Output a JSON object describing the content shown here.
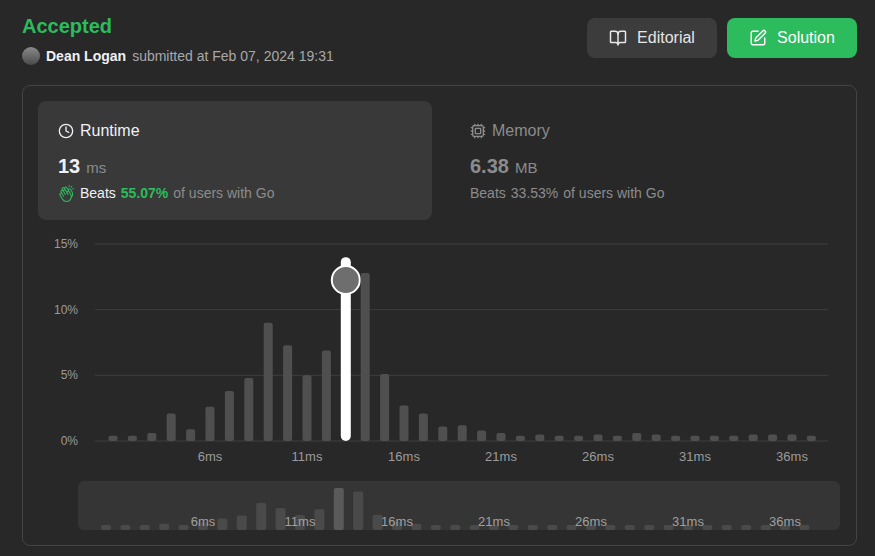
{
  "status": "Accepted",
  "submission": {
    "user": "Dean Logan",
    "submitted": "submitted at Feb 07, 2024 19:31"
  },
  "buttons": [
    {
      "label": "Editorial",
      "kind": "secondary"
    },
    {
      "label": "Solution",
      "kind": "primary"
    }
  ],
  "stats": [
    {
      "label": "Runtime",
      "kind": "runtime",
      "value": "13",
      "unit": "ms",
      "beats": "Beats",
      "percent": "55.07%",
      "suffix": "of users with Go",
      "selected": true
    },
    {
      "label": "Memory",
      "kind": "memory",
      "value": "6.38",
      "unit": "MB",
      "beats": "Beats",
      "percent": "33.53%",
      "suffix": "of users with Go",
      "selected": false
    }
  ],
  "chart": {
    "y_ticks": [
      "15%",
      "10%",
      "5%",
      "0%"
    ],
    "x_ticks": [
      "6ms",
      "11ms",
      "16ms",
      "21ms",
      "26ms",
      "31ms",
      "36ms"
    ],
    "bars": [
      {
        "value": 0.4,
        "selected": false
      },
      {
        "value": 0.4,
        "selected": false
      },
      {
        "value": 0.6,
        "selected": false
      },
      {
        "value": 2.1,
        "selected": false
      },
      {
        "value": 0.9,
        "selected": false
      },
      {
        "value": 2.6,
        "selected": false
      },
      {
        "value": 3.8,
        "selected": false
      },
      {
        "value": 4.8,
        "selected": false
      },
      {
        "value": 9.0,
        "selected": false
      },
      {
        "value": 7.3,
        "selected": false
      },
      {
        "value": 5.0,
        "selected": false
      },
      {
        "value": 6.9,
        "selected": false
      },
      {
        "value": 14.0,
        "selected": true
      },
      {
        "value": 12.8,
        "selected": false
      },
      {
        "value": 5.1,
        "selected": false
      },
      {
        "value": 2.7,
        "selected": false
      },
      {
        "value": 2.1,
        "selected": false
      },
      {
        "value": 1.1,
        "selected": false
      },
      {
        "value": 1.2,
        "selected": false
      },
      {
        "value": 0.8,
        "selected": false
      },
      {
        "value": 0.6,
        "selected": false
      },
      {
        "value": 0.4,
        "selected": false
      },
      {
        "value": 0.5,
        "selected": false
      },
      {
        "value": 0.4,
        "selected": false
      },
      {
        "value": 0.4,
        "selected": false
      },
      {
        "value": 0.5,
        "selected": false
      },
      {
        "value": 0.4,
        "selected": false
      },
      {
        "value": 0.6,
        "selected": false
      },
      {
        "value": 0.5,
        "selected": false
      },
      {
        "value": 0.4,
        "selected": false
      },
      {
        "value": 0.4,
        "selected": false
      },
      {
        "value": 0.4,
        "selected": false
      },
      {
        "value": 0.4,
        "selected": false
      },
      {
        "value": 0.5,
        "selected": false
      },
      {
        "value": 0.5,
        "selected": false
      },
      {
        "value": 0.5,
        "selected": false
      },
      {
        "value": 0.4,
        "selected": false
      }
    ],
    "minimap": {
      "x_ticks": [
        "6ms",
        "11ms",
        "16ms",
        "21ms",
        "26ms",
        "31ms",
        "36ms"
      ]
    }
  }
}
